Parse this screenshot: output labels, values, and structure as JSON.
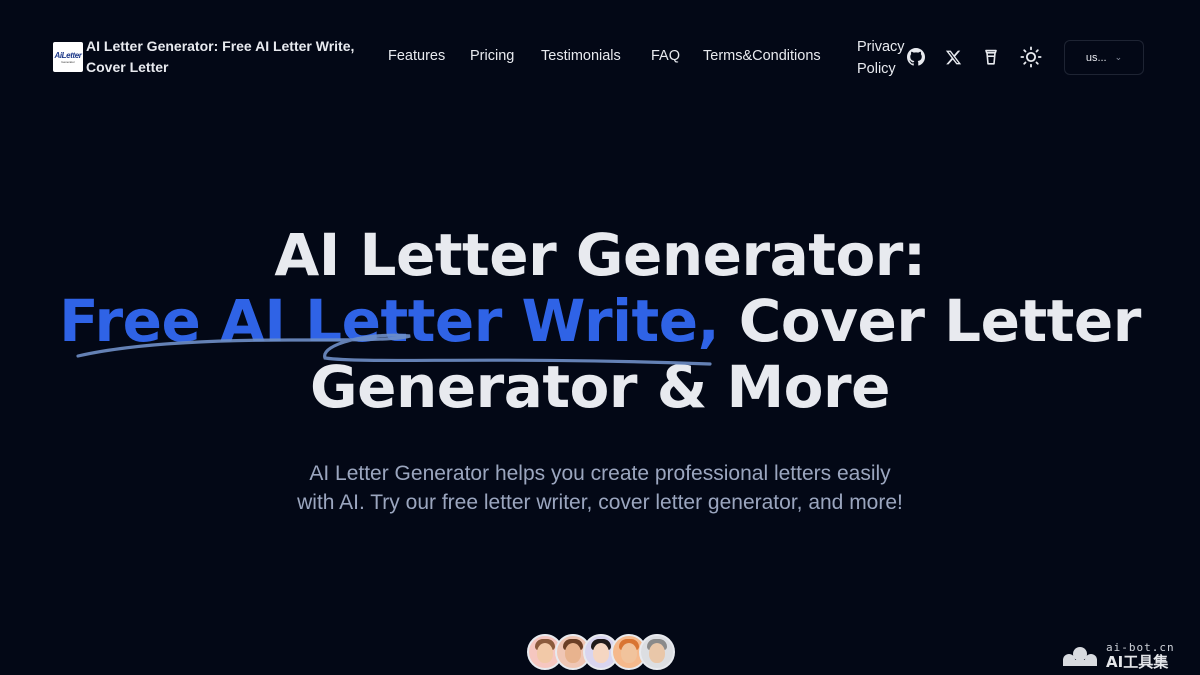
{
  "header": {
    "logo": {
      "main": "AiLetter",
      "sub": "Generator"
    },
    "brand_title": "AI Letter Generator: Free AI Letter Write, Cover Letter",
    "nav": [
      {
        "label": "Features"
      },
      {
        "label": "Pricing"
      },
      {
        "label": "Testimonials"
      },
      {
        "label": "FAQ"
      },
      {
        "label": "Terms&Conditions"
      },
      {
        "label": "Privacy Policy"
      }
    ],
    "icons": [
      "github-icon",
      "x-icon",
      "coffee-icon",
      "sun-icon"
    ],
    "language": {
      "selected": "us...",
      "chevron": "⌄"
    }
  },
  "hero": {
    "title_line1": "AI Letter Generator:",
    "title_line2_highlight": "Free AI Letter Write,",
    "title_line2_rest": " Cover Letter",
    "title_line3": "Generator & More",
    "subtitle": "AI Letter Generator helps you create professional letters easily with AI. Try our free letter writer, cover letter generator, and more!"
  },
  "avatars": [
    {
      "bg": "#f6c7c0",
      "skin": "#f2c9a8",
      "hair": "#8b5a3c"
    },
    {
      "bg": "#f0c6b4",
      "skin": "#e8b38e",
      "hair": "#6b3f25"
    },
    {
      "bg": "#d9d5ef",
      "skin": "#f5d6c2",
      "hair": "#1f1a1a"
    },
    {
      "bg": "#f5b98c",
      "skin": "#f1c39c",
      "hair": "#d97432"
    },
    {
      "bg": "#dcdee2",
      "skin": "#e9c7a9",
      "hair": "#8a8a8a"
    }
  ],
  "watermark": {
    "url": "ai-bot.cn",
    "name": "AI工具集"
  },
  "colors": {
    "background": "#030816",
    "accent": "#2f63e6",
    "text": "#e8eaef",
    "muted": "#9ba6bf"
  }
}
